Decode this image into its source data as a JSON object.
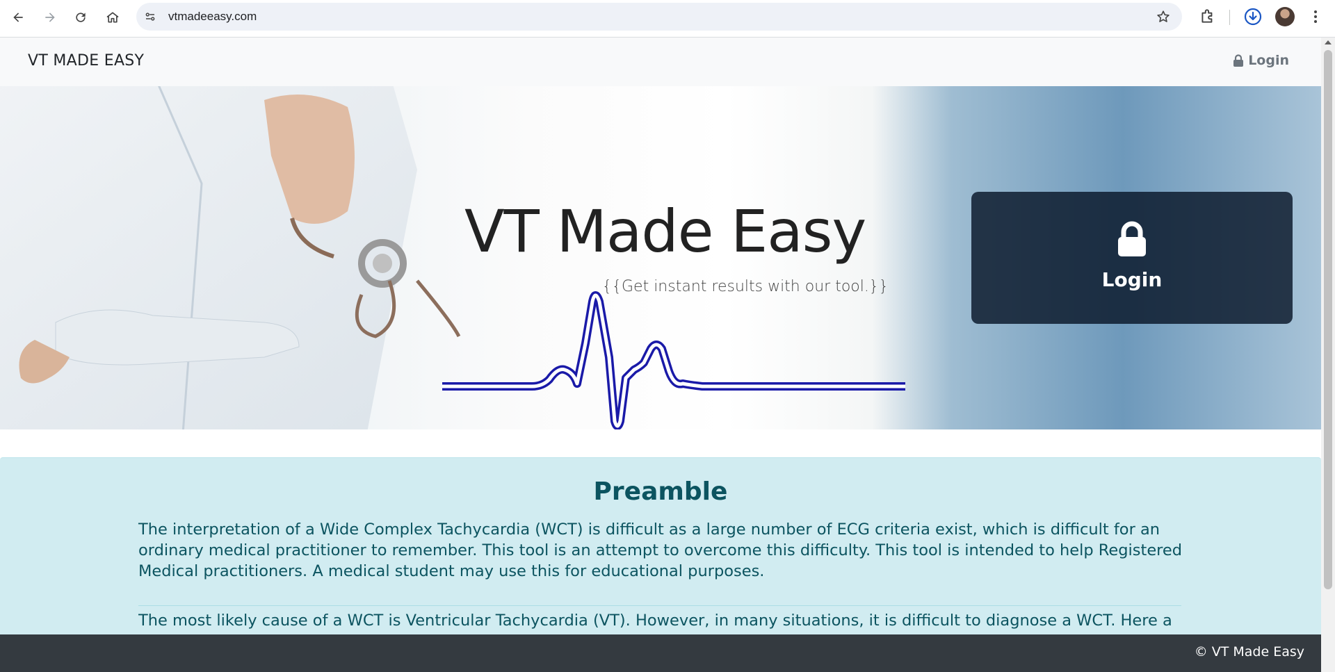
{
  "browser": {
    "url": "vtmadeeasy.com",
    "icons": [
      "back-arrow-icon",
      "forward-arrow-icon",
      "reload-icon",
      "home-icon",
      "site-info-icon",
      "bookmark-star-icon",
      "extensions-icon",
      "download-icon",
      "profile-avatar",
      "kebab-menu-icon"
    ]
  },
  "nav": {
    "brand": "VT MADE EASY",
    "login": "Login"
  },
  "hero": {
    "title": "VT Made Easy",
    "subtitle": "{{Get instant results with our tool.}}",
    "login_card_label": "Login"
  },
  "preamble": {
    "title": "Preamble",
    "paragraph1": "The interpretation of a Wide Complex Tachycardia (WCT) is difficult as a large number of ECG criteria exist, which is difficult for an ordinary medical practitioner to remember. This tool is an attempt to overcome this difficulty. This tool is intended to help Registered Medical practitioners. A medical student may use this for educational purposes.",
    "paragraph2": "The most likely cause of a WCT is Ventricular Tachycardia (VT). However, in many situations, it is difficult to diagnose a WCT. Here a"
  },
  "footer": {
    "copyright": "© VT Made Easy"
  },
  "colors": {
    "info_bg": "#d1ecf1",
    "info_text": "#0c5460",
    "footer_bg": "#343a40",
    "ecg_line": "#1a1aa8",
    "login_card_bg": "#081628"
  }
}
